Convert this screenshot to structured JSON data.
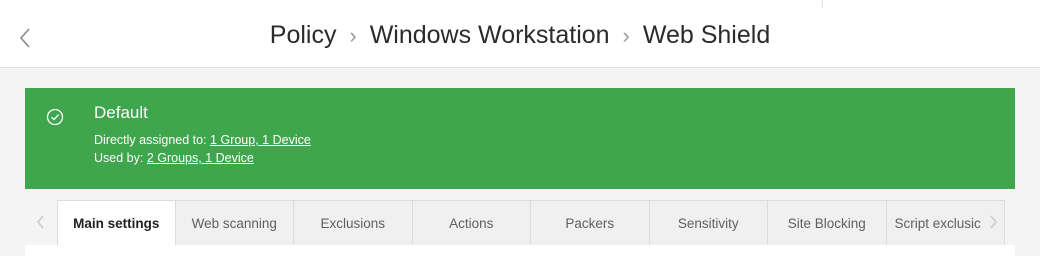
{
  "header": {
    "back_icon": "chevron-left-icon",
    "breadcrumb": [
      "Policy",
      "Windows Workstation",
      "Web Shield"
    ],
    "separator": "›"
  },
  "banner": {
    "color": "#3fa64d",
    "icon": "check-circle-icon",
    "title": "Default",
    "directly_assigned_label": "Directly assigned to:",
    "directly_assigned_link": "1 Group, 1 Device",
    "used_by_label": "Used by:",
    "used_by_link": "2 Groups, 1 Device"
  },
  "tabs": {
    "active": "Main settings",
    "items": [
      {
        "label": "Main settings"
      },
      {
        "label": "Web scanning"
      },
      {
        "label": "Exclusions"
      },
      {
        "label": "Actions"
      },
      {
        "label": "Packers"
      },
      {
        "label": "Sensitivity"
      },
      {
        "label": "Site Blocking"
      },
      {
        "label": "Script exclusic"
      }
    ],
    "left_arrow_icon": "chevron-left-icon",
    "right_arrow_icon": "chevron-right-icon"
  }
}
